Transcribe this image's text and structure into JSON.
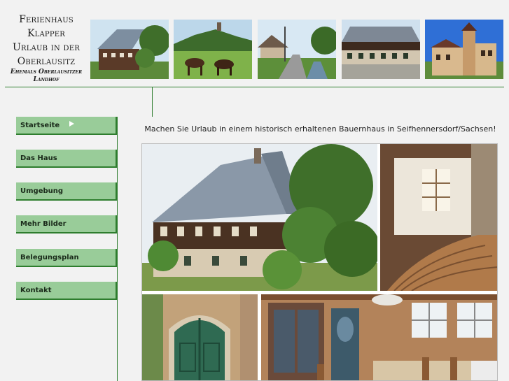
{
  "header": {
    "title_lines": [
      "Ferienhaus",
      "Klapper",
      "Urlaub in der",
      "Oberlausitz"
    ],
    "subtitle_lines": [
      "Ehemals Oberlausitzer",
      "Landhof"
    ]
  },
  "header_photos": [
    {
      "name": "photo-farmhouse-exterior"
    },
    {
      "name": "photo-horses-meadow"
    },
    {
      "name": "photo-village-street"
    },
    {
      "name": "photo-farmhouse-front"
    },
    {
      "name": "photo-villa-tower"
    }
  ],
  "nav": {
    "items": [
      {
        "label": "Startseite",
        "active": true
      },
      {
        "label": "Das Haus",
        "active": false
      },
      {
        "label": "Umgebung",
        "active": false
      },
      {
        "label": "Mehr Bilder",
        "active": false
      },
      {
        "label": "Belegungsplan",
        "active": false
      },
      {
        "label": "Kontakt",
        "active": false
      }
    ]
  },
  "main": {
    "tagline": "Machen Sie Urlaub in einem historisch erhaltenen Bauernhaus in Seifhennersdorf/Sachsen!"
  },
  "colors": {
    "accent_green": "#2e7d2e",
    "nav_bg": "#99cc99",
    "page_bg": "#f2f2f2"
  }
}
